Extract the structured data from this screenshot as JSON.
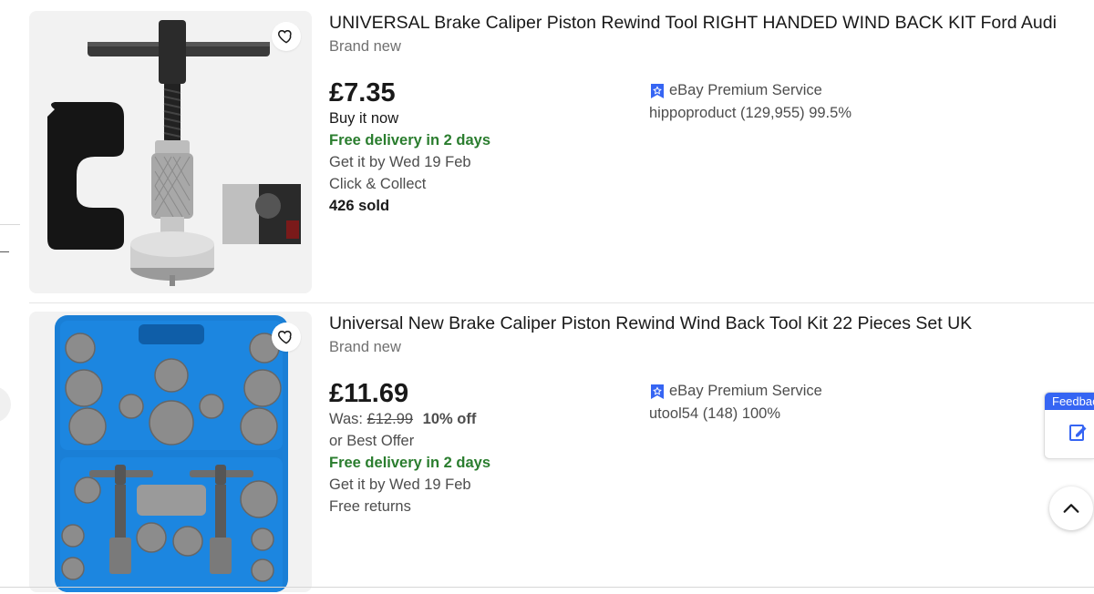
{
  "listings": [
    {
      "title": "UNIVERSAL Brake Caliper Piston Rewind Tool RIGHT HANDED WIND BACK KIT Ford Audi",
      "condition": "Brand new",
      "price": "£7.35",
      "format": "Buy it now",
      "delivery": "Free delivery in 2 days",
      "get_it_by": "Get it by Wed 19 Feb",
      "collect": "Click & Collect",
      "sold": "426 sold",
      "premium": "eBay Premium Service",
      "seller": "hippoproduct (129,955) 99.5%",
      "image": "brake-caliper-rewind-tool"
    },
    {
      "title": "Universal New Brake Caliper Piston Rewind Wind Back Tool Kit 22 Pieces Set UK",
      "condition": "Brand new",
      "price": "£11.69",
      "was_label": "Was:",
      "was_price": "£12.99",
      "discount": "10% off",
      "best_offer": "or Best Offer",
      "delivery": "Free delivery in 2 days",
      "get_it_by": "Get it by Wed 19 Feb",
      "returns": "Free returns",
      "premium": "eBay Premium Service",
      "seller": "utool54 (148) 100%",
      "image": "brake-caliper-tool-kit-case"
    }
  ],
  "feedback": {
    "label": "Feedback"
  },
  "icons": {
    "heart": "heart-outline-icon",
    "premium": "premium-badge-icon",
    "feedback": "feedback-pencil-icon",
    "back_to_top": "chevron-up-icon"
  },
  "colors": {
    "green": "#2a7d2e",
    "premium_blue": "#3665f3",
    "thumb_bg": "#f2f2f2",
    "case_blue": "#1a7fd6"
  }
}
